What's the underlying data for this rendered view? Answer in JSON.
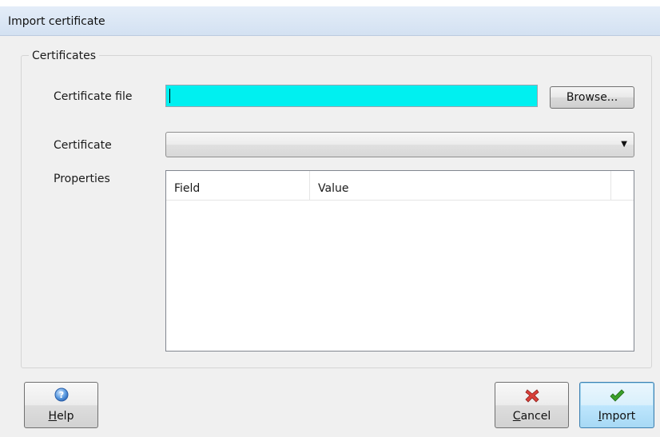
{
  "window": {
    "title": "Import certificate"
  },
  "group": {
    "legend": "Certificates"
  },
  "form": {
    "certificate_file_label": "Certificate file",
    "certificate_file_value": "",
    "browse_label": "Browse...",
    "certificate_label": "Certificate",
    "certificate_selected": "",
    "properties_label": "Properties"
  },
  "properties_table": {
    "columns": [
      "Field",
      "Value"
    ],
    "rows": []
  },
  "buttons": {
    "help": "Help",
    "cancel": "Cancel",
    "import": "Import"
  },
  "icons": {
    "help": "help-icon",
    "cancel": "cancel-x-icon",
    "import": "checkmark-icon",
    "dropdown": "chevron-down-icon"
  },
  "colors": {
    "input_highlight": "#00f0f0",
    "titlebar": "#d3e1f2",
    "cancel_icon": "#d9403a",
    "import_icon": "#3aa02a",
    "help_icon": "#3b7fd0"
  }
}
